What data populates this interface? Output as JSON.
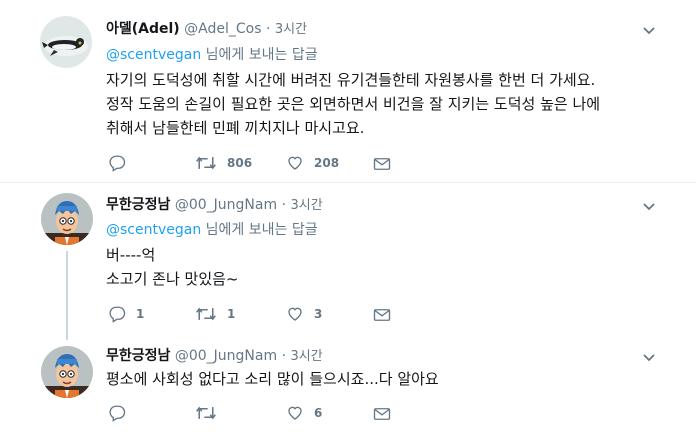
{
  "tweets": [
    {
      "display_name": "아델(Adel)",
      "handle": "@Adel_Cos",
      "dot": "·",
      "time": "3시간",
      "reply_mention": "@scentvegan",
      "reply_suffix": "님에게 보내는 답글",
      "lines": [
        "자기의 도덕성에 취할 시간에 버려진 유기견들한테 자원봉사를 한번 더 가세요.",
        "정작 도움의 손길이 필요한 곳은 외면하면서 비건을 잘 지키는 도덕성 높은 나에",
        "취해서 남들한테 민폐 끼치지나 마시고요."
      ],
      "retweets": "806",
      "likes": "208",
      "avatar_icon": "penguin-icon"
    },
    {
      "display_name": "무한긍정남",
      "handle": "@00_JungNam",
      "dot": "·",
      "time": "3시간",
      "reply_mention": "@scentvegan",
      "reply_suffix": "님에게 보내는 답글",
      "lines": [
        "버----억",
        "소고기 존나 맛있음~"
      ],
      "replies": "1",
      "retweets": "1",
      "likes": "3",
      "avatar_icon": "cartoon-boy-icon"
    },
    {
      "display_name": "무한긍정남",
      "handle": "@00_JungNam",
      "dot": "·",
      "time": "3시간",
      "lines": [
        "평소에 사회성 없다고 소리 많이 들으시죠...다 알아요"
      ],
      "likes": "6",
      "avatar_icon": "cartoon-boy-icon"
    }
  ],
  "colors": {
    "text": "#14171a",
    "secondary": "#657786",
    "link": "#1da1f2",
    "divider": "#e6ecf0",
    "thread_line": "#ccd6dd"
  }
}
